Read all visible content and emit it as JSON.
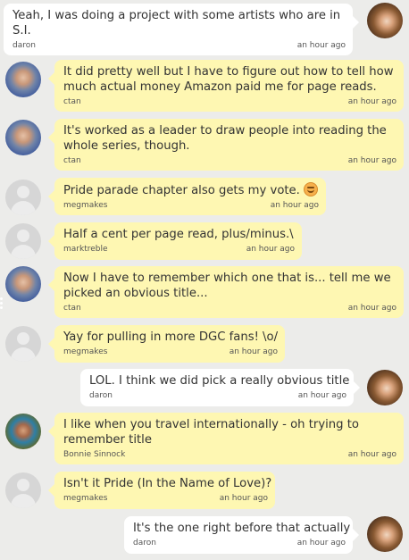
{
  "messages": [
    {
      "author": "daron",
      "lines": [
        "Yeah, I was doing a project with some artists who are in",
        "S.I."
      ],
      "time": "an hour ago"
    },
    {
      "author": "ctan",
      "lines": [
        "It did pretty well but I have to figure out how to tell how",
        "much actual money Amazon paid me for page reads."
      ],
      "time": "an hour ago"
    },
    {
      "author": "ctan",
      "lines": [
        "It's worked as a leader to draw people into reading the",
        "whole series, though."
      ],
      "time": "an hour ago"
    },
    {
      "author": "megmakes",
      "lines": [
        "Pride parade chapter also gets my vote."
      ],
      "emoji": "smiling-face",
      "time": "an hour ago"
    },
    {
      "author": "marktreble",
      "lines": [
        "Half a cent per page read, plus/minus.\\"
      ],
      "time": "an hour ago"
    },
    {
      "author": "ctan",
      "lines": [
        "Now I have to remember which one that is... tell me we",
        "picked an obvious title..."
      ],
      "time": "an hour ago"
    },
    {
      "author": "megmakes",
      "lines": [
        "Yay for pulling in more DGC fans! \\o/"
      ],
      "time": "an hour ago"
    },
    {
      "author": "daron",
      "lines": [
        "LOL. I think we did pick a really obvious title"
      ],
      "time": "an hour ago"
    },
    {
      "author": "Bonnie Sinnock",
      "lines": [
        "I like when you travel internationally - oh trying to",
        "remember title"
      ],
      "time": "an hour ago"
    },
    {
      "author": "megmakes",
      "lines": [
        "Isn't it Pride (In the Name of Love)?"
      ],
      "time": "an hour ago"
    },
    {
      "author": "daron",
      "lines": [
        "It's the one right before that actually"
      ],
      "time": "an hour ago"
    }
  ],
  "colors": {
    "background": "#ececea",
    "own_bubble": "#ffffff",
    "other_bubble": "#fef7b2",
    "text": "#333333",
    "meta_text": "#555555"
  }
}
